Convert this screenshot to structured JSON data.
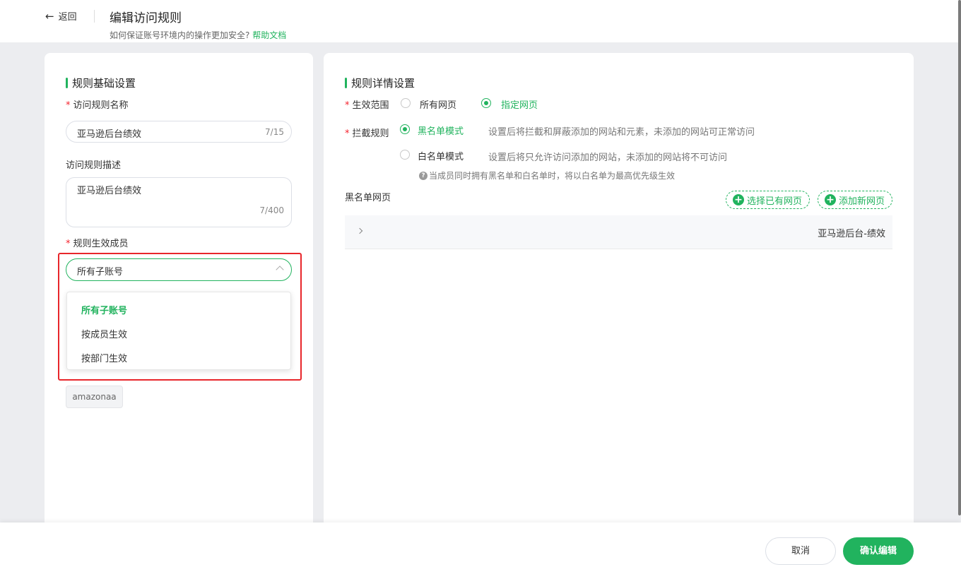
{
  "header": {
    "back_label": "返回",
    "title": "编辑访问规则",
    "subtitle": "如何保证账号环境内的操作更加安全?",
    "help_link": "帮助文档"
  },
  "basic": {
    "section_title": "规则基础设置",
    "name_label": "访问规则名称",
    "name_value": "亚马逊后台绩效",
    "name_count": "7/15",
    "desc_label": "访问规则描述",
    "desc_value": "亚马逊后台绩效",
    "desc_count": "7/400",
    "members_label": "规则生效成员",
    "members_value": "所有子账号",
    "members_options": [
      "所有子账号",
      "按成员生效",
      "按部门生效"
    ],
    "selected_tag": "amazonaa"
  },
  "detail": {
    "section_title": "规则详情设置",
    "scope_label": "生效范围",
    "scope_options": [
      "所有网页",
      "指定网页"
    ],
    "intercept_label": "拦截规则",
    "blacklist_label": "黑名单模式",
    "blacklist_desc": "设置后将拦截和屏蔽添加的网站和元素，未添加的网站可正常访问",
    "whitelist_label": "白名单模式",
    "whitelist_desc": "设置后将只允许访问添加的网站，未添加的网站将不可访问",
    "hint": "当成员同时拥有黑名单和白名单时，将以白名单为最高优先级生效",
    "blacklist_pages_label": "黑名单网页",
    "select_existing_btn": "选择已有网页",
    "add_new_btn": "添加新网页",
    "pages": [
      "亚马逊后台-绩效"
    ]
  },
  "footer": {
    "cancel_label": "取消",
    "confirm_label": "确认编辑"
  },
  "colors": {
    "accent": "#21b35e",
    "highlight": "#e8262b",
    "required": "#f5222d"
  }
}
